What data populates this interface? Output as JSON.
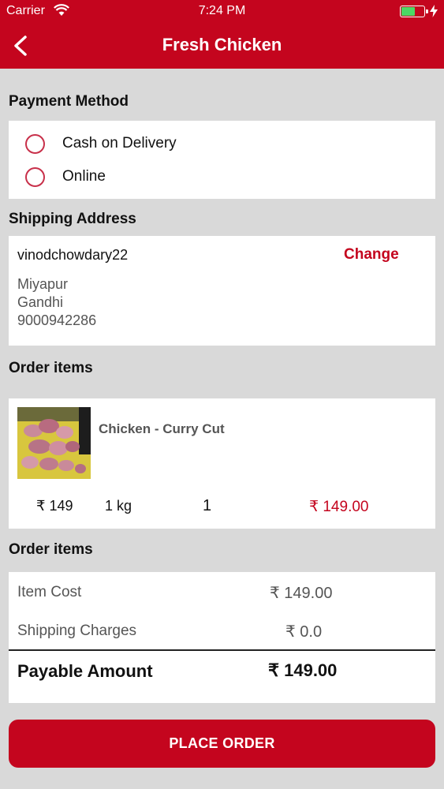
{
  "status_bar": {
    "carrier": "Carrier",
    "time": "7:24 PM"
  },
  "nav": {
    "title": "Fresh Chicken"
  },
  "payment": {
    "title": "Payment Method",
    "options": [
      "Cash on Delivery",
      "Online"
    ]
  },
  "shipping": {
    "title": "Shipping Address",
    "name": "vinodchowdary22",
    "change_label": "Change",
    "lines": [
      "Miyapur",
      "Gandhi",
      "9000942286"
    ]
  },
  "order_items": {
    "title": "Order items",
    "item": {
      "name": "Chicken - Curry Cut",
      "price": "₹ 149",
      "weight": "1 kg",
      "quantity": "1",
      "total": "₹ 149.00"
    }
  },
  "summary": {
    "title": "Order items",
    "item_cost_label": "Item Cost",
    "item_cost_value": "₹ 149.00",
    "shipping_label": "Shipping Charges",
    "shipping_value": "₹ 0.0",
    "payable_label": "Payable Amount",
    "payable_value": "₹ 149.00"
  },
  "place_order_label": "PLACE ORDER",
  "colors": {
    "brand": "#c4051e",
    "radio": "#c8304a",
    "battery": "#4cd964"
  }
}
